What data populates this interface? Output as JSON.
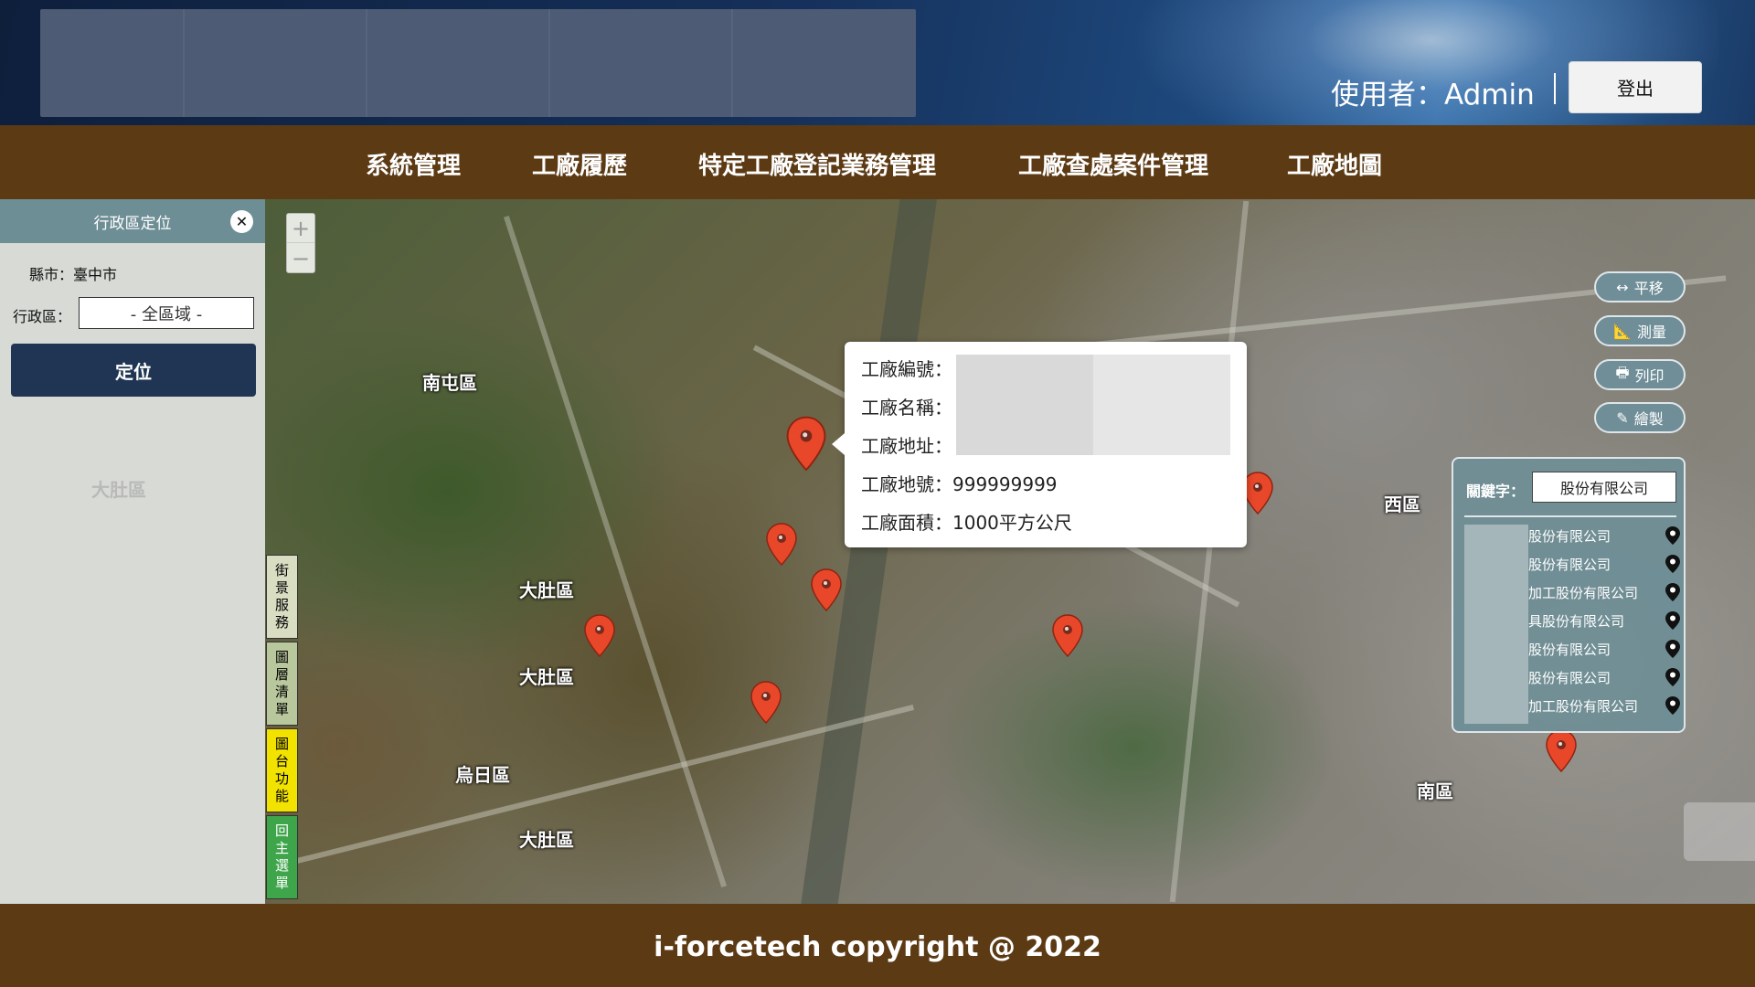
{
  "header": {
    "user_label": "使用者：Admin",
    "logout_label": "登出"
  },
  "nav": {
    "items": [
      {
        "label": "系統管理"
      },
      {
        "label": "工廠履歷"
      },
      {
        "label": "特定工廠登記業務管理"
      },
      {
        "label": "工廠查處案件管理"
      },
      {
        "label": "工廠地圖"
      }
    ]
  },
  "side_panel": {
    "title": "行政區定位",
    "close_icon": "close-icon",
    "county": "縣市：臺中市",
    "district_label": "行政區：",
    "district_value": "- 全區域 -",
    "locate_label": "定位",
    "watermark": "大肚區"
  },
  "vertical_tabs": [
    {
      "label": "街景服務",
      "color": "#d9ddc2"
    },
    {
      "label": "圖層清單",
      "color": "#b9c79c"
    },
    {
      "label": "圖台功能",
      "color": "#f2e200"
    },
    {
      "label": "回主選單",
      "color": "#3ea54b"
    }
  ],
  "map": {
    "labels": [
      "南屯區",
      "大肚區",
      "大肚區",
      "烏日區",
      "大肚區",
      "西區",
      "南區",
      "南屯區"
    ],
    "zoom_in": "+",
    "zoom_out": "−"
  },
  "popup": {
    "rows": [
      {
        "label": "工廠編號：",
        "value": ""
      },
      {
        "label": "工廠名稱：",
        "value": ""
      },
      {
        "label": "工廠地址：",
        "value": ""
      },
      {
        "label": "工廠地號：",
        "value": "999999999"
      },
      {
        "label": "工廠面積：",
        "value": "1000平方公尺"
      }
    ]
  },
  "tools": [
    {
      "label": "平移",
      "icon": "pan-arrows-icon"
    },
    {
      "label": "測量",
      "icon": "ruler-icon"
    },
    {
      "label": "列印",
      "icon": "printer-icon"
    },
    {
      "label": "繪製",
      "icon": "draw-tools-icon"
    }
  ],
  "keyword_panel": {
    "label": "關鍵字：",
    "value": "股份有限公司",
    "results": [
      "股份有限公司",
      "股份有限公司",
      "加工股份有限公司",
      "具股份有限公司",
      "股份有限公司",
      "股份有限公司",
      "加工股份有限公司"
    ]
  },
  "footer": {
    "copyright": "i-forcetech copyright @ 2022"
  },
  "colors": {
    "header_dark": "#15305a",
    "brown": "#5c3a14",
    "panel_teal": "#6e8e95",
    "button_navy": "#1f3553",
    "pin_red": "#e8472a"
  }
}
